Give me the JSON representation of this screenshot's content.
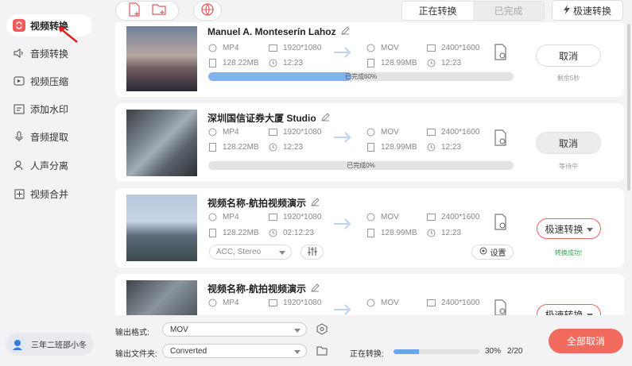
{
  "sidebar": {
    "items": [
      {
        "label": "视频转换",
        "icon": "convert-icon"
      },
      {
        "label": "音频转换",
        "icon": "audio-icon"
      },
      {
        "label": "视频压缩",
        "icon": "compress-icon"
      },
      {
        "label": "添加水印",
        "icon": "watermark-icon"
      },
      {
        "label": "音频提取",
        "icon": "extract-icon"
      },
      {
        "label": "人声分离",
        "icon": "voice-icon"
      },
      {
        "label": "视频合并",
        "icon": "merge-icon"
      }
    ],
    "user": "三年二班邵小冬"
  },
  "topbar": {
    "tabs": [
      "正在转换",
      "已完成"
    ],
    "fast_label": "极速转换"
  },
  "cards": [
    {
      "title": "Manuel A. Monteserín Lahoz",
      "src_format": "MP4",
      "src_res": "1920*1080",
      "src_size": "128.22MB",
      "src_dur": "12:23",
      "dst_format": "MOV",
      "dst_res": "2400*1600",
      "dst_size": "128.99MB",
      "dst_dur": "12:23",
      "progress_label": "已完成60%",
      "progress": 0.47,
      "action": "取消",
      "status": "剩余5秒"
    },
    {
      "title": "深圳国信证券大厦  Studio",
      "src_format": "MP4",
      "src_res": "1920*1080",
      "src_size": "128.22MB",
      "src_dur": "12:23",
      "dst_format": "MOV",
      "dst_res": "2400*1600",
      "dst_size": "128.99MB",
      "dst_dur": "12:23",
      "progress_label": "已完成0%",
      "progress": 0,
      "action": "取消",
      "status": "等待中"
    },
    {
      "title": "视频名称-航拍视频演示",
      "src_format": "MP4",
      "src_res": "1920*1080",
      "src_size": "128.22MB",
      "src_dur": "02:12:23",
      "dst_format": "MOV",
      "dst_res": "2400*1600",
      "dst_size": "128.99MB",
      "dst_dur": "12:23",
      "audio": "ACC, Stereo",
      "settings": "设置",
      "action": "极速转换",
      "status": "转换成功!"
    },
    {
      "title": "视频名称-航拍视频演示",
      "src_format": "MP4",
      "src_res": "1920*1080",
      "dst_format": "MOV",
      "dst_res": "2400*1600",
      "action": "极速转换"
    }
  ],
  "bottom": {
    "format_label": "输出格式:",
    "format_value": "MOV",
    "folder_label": "输出文件夹:",
    "folder_value": "Converted",
    "converting_label": "正在转换:",
    "percent": "30%",
    "count": "2/20",
    "progress": 0.3,
    "cancel_all": "全部取消"
  },
  "colors": {
    "accent": "#f26b5e",
    "progress": "#82b3ee",
    "success": "#2eaa4f"
  }
}
